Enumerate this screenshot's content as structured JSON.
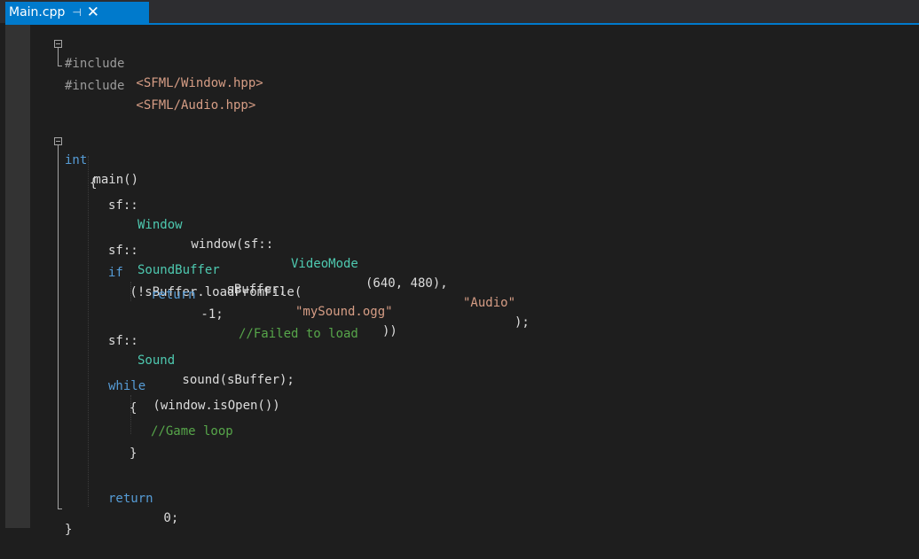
{
  "tab": {
    "title": "Main.cpp",
    "pin_icon": "pin-icon",
    "close_icon": "close-icon",
    "pin_glyph": "⊣",
    "close_glyph": "✕"
  },
  "colors": {
    "accent": "#007acc",
    "keyword": "#569cd6",
    "string": "#d69d85",
    "comment": "#57a64a",
    "type": "#4ec9b0",
    "text": "#dcdcdc"
  },
  "code": {
    "l1": {
      "a": "#include",
      "b": " <SFML/Window.hpp>"
    },
    "l2": {
      "a": "#include",
      "b": " <SFML/Audio.hpp>"
    },
    "l3": {
      "a": "int",
      "b": " main()"
    },
    "l4": {
      "a": "{"
    },
    "l5": {
      "a": "sf::",
      "b": "Window",
      "c": " window(sf::",
      "d": "VideoMode",
      "e": "(640, 480), ",
      "f": "\"Audio\"",
      "g": ");"
    },
    "l6": {
      "a": "sf::",
      "b": "SoundBuffer",
      "c": " sBuffer;"
    },
    "l7": {
      "a": "if",
      "b": " (!sBuffer.loadFromFile(",
      "c": "\"mySound.ogg\"",
      "d": "))"
    },
    "l8": {
      "a": "return",
      "b": " -1; ",
      "c": "//Failed to load"
    },
    "l9": {
      "a": "sf::",
      "b": "Sound",
      "c": " sound(sBuffer);"
    },
    "l10": {
      "a": "while",
      "b": " (window.isOpen())"
    },
    "l11": {
      "a": "{"
    },
    "l12": {
      "a": "//Game loop"
    },
    "l13": {
      "a": "}"
    },
    "l14": {
      "a": "return",
      "b": " 0;"
    },
    "l15": {
      "a": "}"
    }
  }
}
